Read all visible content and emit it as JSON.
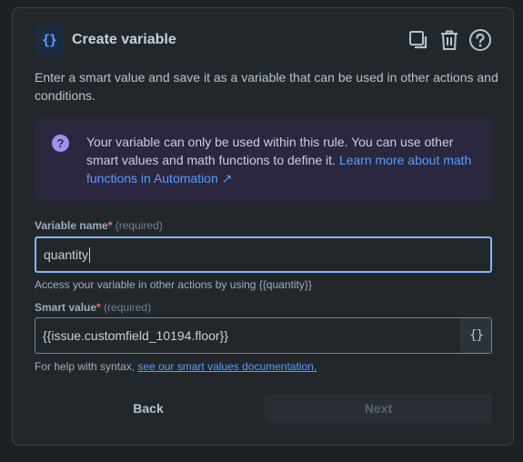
{
  "dialog": {
    "title": "Create variable",
    "title_icon_text": "{}",
    "icons": [
      "copy-icon",
      "trash-icon",
      "help-icon"
    ],
    "description": "Enter a smart value and save it as a variable that can be used in other actions and conditions."
  },
  "info": {
    "icon": "?",
    "text": "Your variable can only be used within this rule. You can use other smart values and math functions to define it. ",
    "link_text": "Learn more about math functions in Automation ↗"
  },
  "variable_name": {
    "label": "Variable name",
    "required_mark": "*",
    "required_text": "(required)",
    "value": "quantity",
    "helper": "Access your variable in other actions by using {{quantity}}"
  },
  "smart_value": {
    "label": "Smart value",
    "required_mark": "*",
    "required_text": "(required)",
    "value": "{{issue.customfield_10194.floor}}",
    "braces_button": "{}",
    "helper_prefix": "For help with syntax, ",
    "helper_link": "see our smart values documentation."
  },
  "buttons": {
    "back": "Back",
    "next": "Next"
  },
  "colors": {
    "accent": "#579dff",
    "focus_border": "#85b8ff",
    "info_bg": "#2b273f",
    "info_icon": "#9f8fef",
    "required": "#f87168"
  }
}
